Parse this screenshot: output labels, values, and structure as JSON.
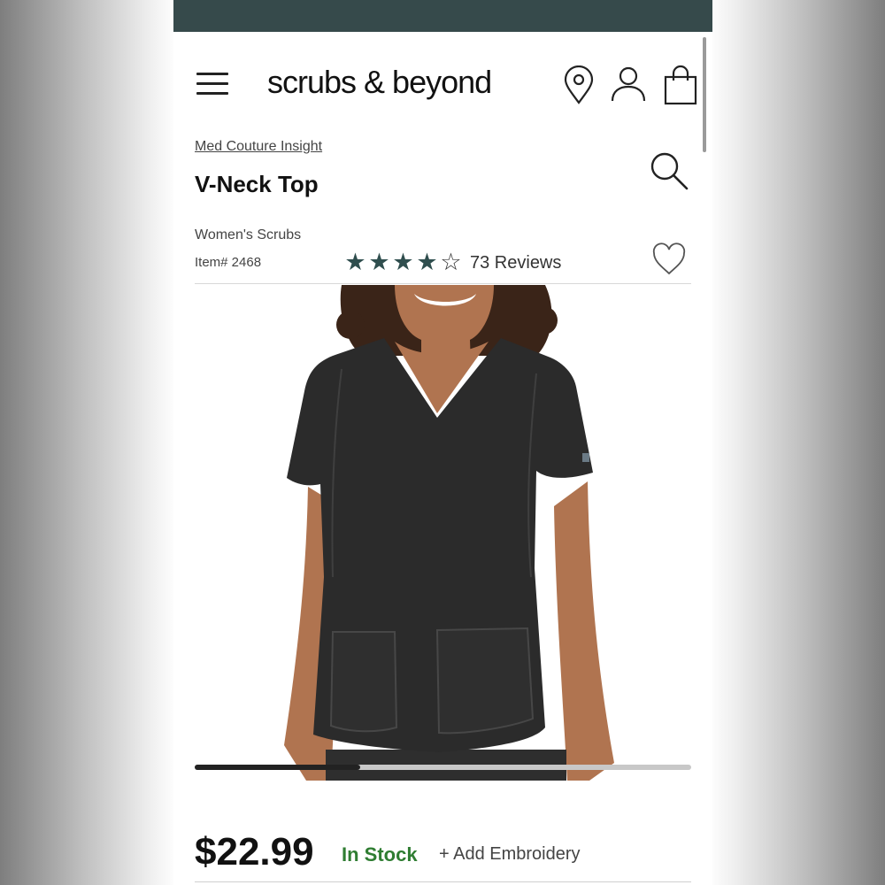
{
  "header": {
    "brand": "scrubs & beyond",
    "icons": [
      "menu-icon",
      "location-pin-icon",
      "account-icon",
      "shopping-bag-icon"
    ]
  },
  "product": {
    "brand_link": "Med Couture Insight",
    "title": "V-Neck Top",
    "category": "Women's Scrubs",
    "item_number": "Item# 2468",
    "rating": {
      "stars_filled": 4,
      "stars_total": 5,
      "reviews_label": "73 Reviews"
    },
    "price": "$22.99",
    "stock_status": "In Stock",
    "embroidery_label": "+ Add Embroidery"
  },
  "carousel": {
    "current_index": 1,
    "total_images": 3
  },
  "colors": {
    "top_bar": "#364a4b",
    "star": "#2f4e4e",
    "in_stock": "#2f7d32",
    "garment": "#2b2b2b"
  }
}
